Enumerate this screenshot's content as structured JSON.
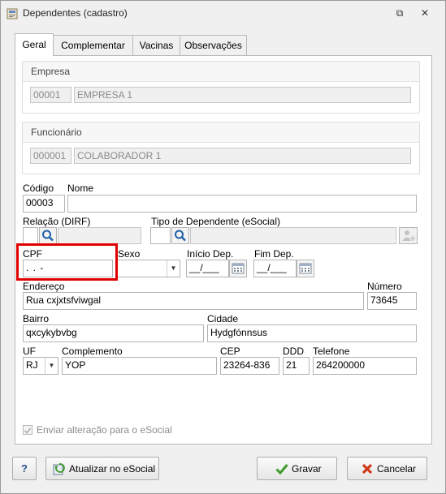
{
  "window": {
    "title": "Dependentes (cadastro)",
    "restore_glyph": "⧉",
    "close_glyph": "✕"
  },
  "tabs": [
    {
      "label": "Geral"
    },
    {
      "label": "Complementar"
    },
    {
      "label": "Vacinas"
    },
    {
      "label": "Observações"
    }
  ],
  "empresa": {
    "title": "Empresa",
    "code": "00001",
    "name": "EMPRESA 1"
  },
  "funcionario": {
    "title": "Funcionário",
    "code": "000001",
    "name": "COLABORADOR 1"
  },
  "form": {
    "codigo_label": "Código",
    "codigo_value": "00003",
    "nome_label": "Nome",
    "nome_value": "",
    "relacao_label": "Relação (DIRF)",
    "relacao_value": "",
    "tipo_dep_label": "Tipo de Dependente (eSocial)",
    "tipo_dep_value": "",
    "cpf_label": "CPF",
    "cpf_value": "   .   .   -",
    "sexo_label": "Sexo",
    "sexo_value": "",
    "inicio_dep_label": "Início Dep.",
    "inicio_dep_value": "__/___",
    "fim_dep_label": "Fim Dep.",
    "fim_dep_value": "__/___",
    "endereco_label": "Endereço",
    "endereco_value": "Rua cxjxtsfviwgal",
    "numero_label": "Número",
    "numero_value": "73645",
    "bairro_label": "Bairro",
    "bairro_value": "qxcykybvbg",
    "cidade_label": "Cidade",
    "cidade_value": "Hydgfónnsus",
    "uf_label": "UF",
    "uf_value": "RJ",
    "complemento_label": "Complemento",
    "complemento_value": "YOP",
    "cep_label": "CEP",
    "cep_value": "23264-836",
    "ddd_label": "DDD",
    "ddd_value": "21",
    "telefone_label": "Telefone",
    "telefone_value": "264200000",
    "esocial_checkbox_label": "Enviar alteração para o eSocial"
  },
  "footer": {
    "help_label": "?",
    "atualizar_label": "Atualizar no eSocial",
    "gravar_label": "Gravar",
    "cancelar_label": "Cancelar"
  },
  "colors": {
    "highlight": "#e10000",
    "save_check": "#3d9b2a",
    "cancel_x": "#d03a1a"
  }
}
